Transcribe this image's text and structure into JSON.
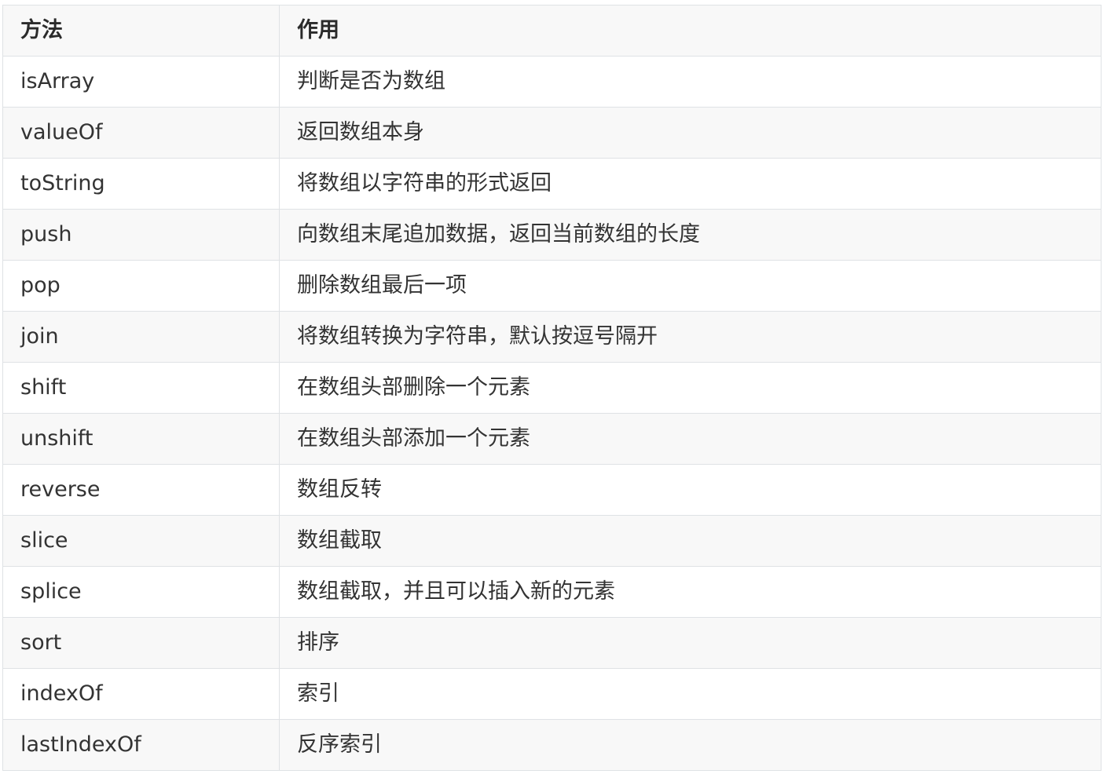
{
  "table": {
    "headers": [
      "方法",
      "作用"
    ],
    "rows": [
      [
        "isArray",
        "判断是否为数组"
      ],
      [
        "valueOf",
        "返回数组本身"
      ],
      [
        "toString",
        "将数组以字符串的形式返回"
      ],
      [
        "push",
        "向数组末尾追加数据，返回当前数组的长度"
      ],
      [
        "pop",
        "删除数组最后一项"
      ],
      [
        "join",
        "将数组转换为字符串，默认按逗号隔开"
      ],
      [
        "shift",
        "在数组头部删除一个元素"
      ],
      [
        "unshift",
        "在数组头部添加一个元素"
      ],
      [
        "reverse",
        "数组反转"
      ],
      [
        "slice",
        "数组截取"
      ],
      [
        "splice",
        "数组截取，并且可以插入新的元素"
      ],
      [
        "sort",
        "排序"
      ],
      [
        "indexOf",
        "索引"
      ],
      [
        "lastIndexOf",
        "反序索引"
      ]
    ]
  }
}
